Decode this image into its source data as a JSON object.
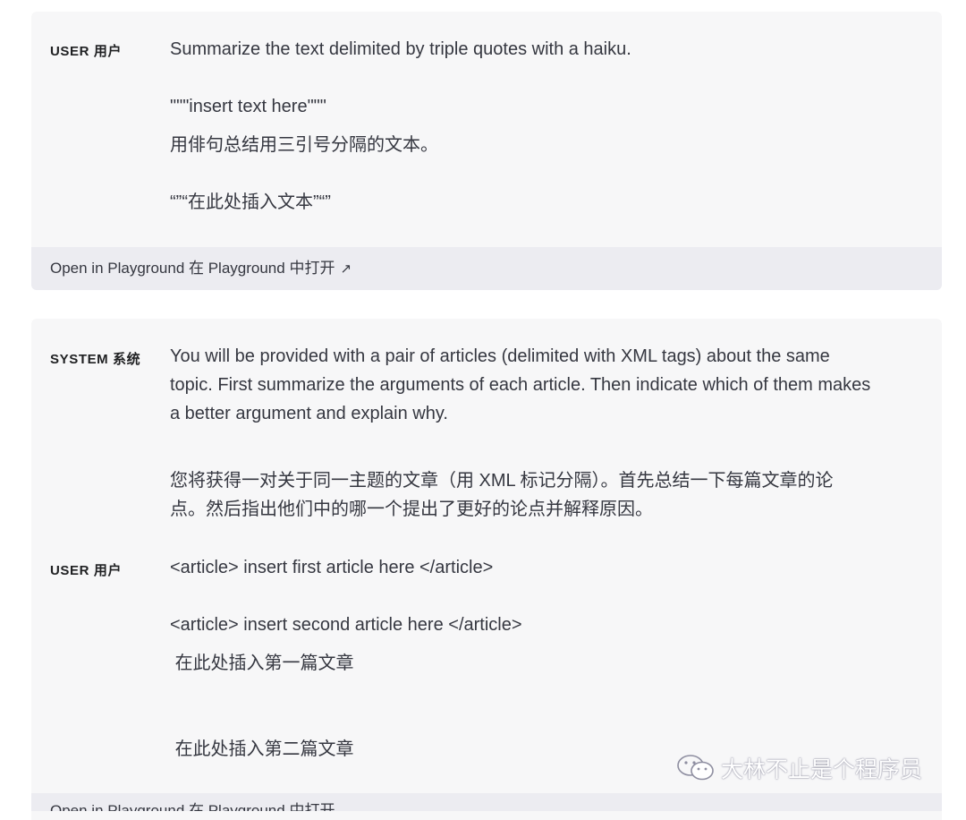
{
  "card1": {
    "role_label": "USER 用户",
    "lines": [
      "Summarize the text delimited by triple quotes with a haiku.",
      "\"\"\"insert text here\"\"\"",
      "用俳句总结用三引号分隔的文本。",
      "“”“在此处插入文本”“”"
    ],
    "footer_label": "Open in Playground 在 Playground 中打开",
    "footer_icon": "↗"
  },
  "card2": {
    "system_role_label": "SYSTEM 系统",
    "system_lines": [
      "You will be provided with a pair of articles (delimited with XML tags) about the same",
      "topic. First summarize the arguments of each article. Then indicate which of them makes",
      "a better argument and explain why.",
      "您将获得一对关于同一主题的文章（用 XML 标记分隔）。首先总结一下每篇文章的论",
      "点。然后指出他们中的哪一个提出了更好的论点并解释原因。"
    ],
    "user_role_label": "USER 用户",
    "user_lines": [
      "<article> insert first article here </article>",
      "<article> insert second article here </article>",
      " 在此处插入第一篇文章",
      " 在此处插入第二篇文章"
    ],
    "footer_label": "Open in Playground 在 Playground 中打开"
  },
  "watermark": {
    "text": "大林不止是个程序员",
    "icon": "wechat-icon"
  }
}
